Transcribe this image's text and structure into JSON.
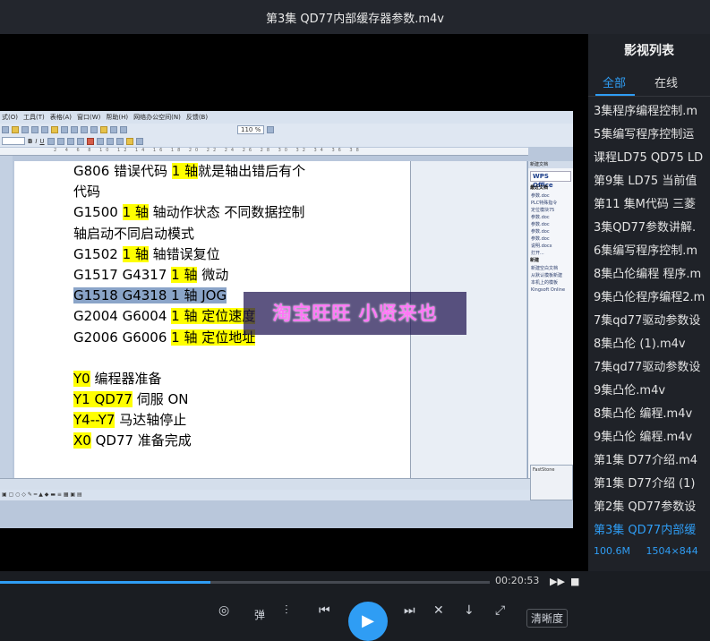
{
  "window": {
    "title": "第3集  QD77内部缓存器参数.m4v"
  },
  "word": {
    "menu": [
      "式(O)",
      "工具(T)",
      "表格(A)",
      "窗口(W)",
      "帮助(H)",
      "网络办公空间(N)",
      "反馈(B)"
    ],
    "zoom": "110 %",
    "ruler_marks": "2 4 6 8 10 12 14 16 18 20 22 24 26 28 30 32 34 36 38",
    "lines": [
      [
        {
          "t": "G806 错误代码    "
        },
        {
          "t": "1 轴",
          "hl": true
        },
        {
          "t": "就是轴出错后有个"
        }
      ],
      [
        {
          "t": "代码"
        }
      ],
      [
        {
          "t": "G1500 "
        },
        {
          "t": "1 轴",
          "hl": true
        },
        {
          "t": "  轴动作状态    不同数据控制"
        }
      ],
      [
        {
          "t": "轴启动不同启动模式"
        }
      ],
      [
        {
          "t": "G1502 "
        },
        {
          "t": "1 轴",
          "hl": true
        },
        {
          "t": "  轴错误复位"
        }
      ],
      [
        {
          "t": "G1517 G4317 "
        },
        {
          "t": "1 轴",
          "hl": true
        },
        {
          "t": "    微动"
        }
      ],
      [
        {
          "t": "G1518 G4318     1 轴   JOG",
          "sel": true
        }
      ],
      [
        {
          "t": "G2004 G6004    "
        },
        {
          "t": "1 轴  定位速度",
          "hl": true
        }
      ],
      [
        {
          "t": "G2006 G6006    "
        },
        {
          "t": "1 轴  定位地址",
          "hl": true
        }
      ],
      [],
      [
        {
          "t": "Y0",
          "hl": true
        },
        {
          "t": "  编程器准备"
        }
      ],
      [
        {
          "t": "Y1 QD77",
          "hl": true
        },
        {
          "t": " 伺服 ON"
        }
      ],
      [
        {
          "t": "Y4--Y7",
          "hl": true
        },
        {
          "t": "    马达轴停止"
        }
      ],
      [
        {
          "t": "X0",
          "hl": true
        },
        {
          "t": "    QD77 准备完成"
        }
      ]
    ],
    "sidepane": {
      "header": "新建文档",
      "brand": "WPS Office",
      "recent_label": "最近文档",
      "recent": [
        "参数.doc",
        "PLC特殊指令",
        "定位模块75",
        "参数.doc",
        "参数.doc",
        "参数.doc",
        "参数.doc",
        "说明.docx",
        "打开..."
      ],
      "new_label": "新建",
      "new_items": [
        "新建空白文档",
        "从默认模板新建",
        "本机上的模板",
        "Kingsoft Online"
      ],
      "fastone": "FastStone"
    }
  },
  "watermark": "淘宝旺旺 小贤来也",
  "playlist": {
    "title": "影视列表",
    "tabs": [
      "全部",
      "在线"
    ],
    "items": [
      "3集程序编程控制.m",
      "5集编写程序控制运",
      "课程LD75 QD75 LD",
      "第9集 LD75 当前值",
      "第11 集M代码 三菱",
      "3集QD77参数讲解.",
      "6集编写程序控制.m",
      "8集凸伦编程 程序.m",
      "9集凸伦程序编程2.m",
      "7集qd77驱动参数设",
      "8集凸伦 (1).m4v",
      "7集qd77驱动参数设",
      "9集凸伦.m4v",
      "8集凸伦 编程.m4v",
      "9集凸伦 编程.m4v",
      "第1集  D77介绍.m4",
      "第1集  D77介绍 (1)",
      "第2集  QD77参数设",
      "第3集  QD77内部缓"
    ],
    "current_index": 18,
    "file_size": "100.6M",
    "resolution": "1504×844"
  },
  "player": {
    "time": "00:20:53",
    "progress": 0.43,
    "danmu_label": "弹",
    "quality_label": "清晰度",
    "accent": "#2f9df4"
  }
}
